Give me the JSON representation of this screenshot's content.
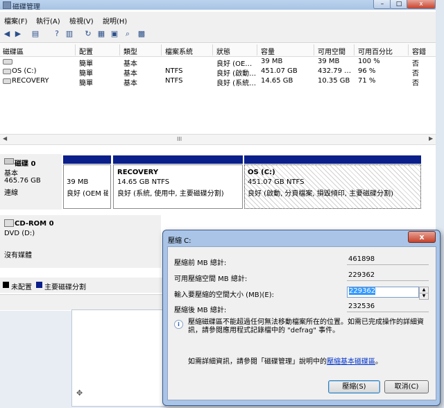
{
  "window": {
    "title": "磁碟管理"
  },
  "menu": [
    "檔案(F)",
    "執行(A)",
    "檢視(V)",
    "說明(H)"
  ],
  "columns": [
    "磁碟區",
    "配置",
    "類型",
    "檔案系統",
    "狀態",
    "容量",
    "可用空間",
    "可用百分比",
    "容錯"
  ],
  "volumes": [
    {
      "name": "",
      "layout": "簡單",
      "type": "基本",
      "fs": "",
      "status": "良好 (OE…",
      "capacity": "39 MB",
      "free": "39 MB",
      "pct": "100 %",
      "ft": "否"
    },
    {
      "name": "OS (C:)",
      "layout": "簡單",
      "type": "基本",
      "fs": "NTFS",
      "status": "良好 (啟動…",
      "capacity": "451.07 GB",
      "free": "432.79 …",
      "pct": "96 %",
      "ft": "否"
    },
    {
      "name": "RECOVERY",
      "layout": "簡單",
      "type": "基本",
      "fs": "NTFS",
      "status": "良好 (系統…",
      "capacity": "14.65 GB",
      "free": "10.35 GB",
      "pct": "71 %",
      "ft": "否"
    }
  ],
  "scroll": {
    "mid_glyph": "III"
  },
  "disk0": {
    "label": "磁碟 0",
    "type": "基本",
    "size": "465.76 GB",
    "state": "連線",
    "partitions": [
      {
        "title": "",
        "size": "39 MB",
        "status": "良好 (OEM 磁"
      },
      {
        "title": "RECOVERY",
        "size": "14.65 GB NTFS",
        "status": "良好 (系統, 使用中, 主要磁碟分割)"
      },
      {
        "title": "OS  (C:)",
        "size": "451.07 GB NTFS",
        "status": "良好 (啟動, 分頁檔案, 損毀傾印, 主要磁碟分割)"
      }
    ]
  },
  "cdrom": {
    "label": "CD-ROM 0",
    "drive": "DVD (D:)",
    "media": "沒有媒體"
  },
  "legend": {
    "unallocated": "未配置",
    "primary": "主要磁碟分割"
  },
  "dialog": {
    "title": "壓縮 C:",
    "total_before_label": "壓縮前 MB 總計:",
    "total_before": "461898",
    "available_label": "可用壓縮空間 MB 總計:",
    "available": "229362",
    "amount_label": "輸入要壓縮的空間大小 (MB)(E):",
    "amount": "229362",
    "total_after_label": "壓縮後 MB 總計:",
    "total_after": "232536",
    "info": "壓縮磁碟區不能超過任何無法移動檔案所在的位置。如需已完成操作的詳細資訊，請參閱應用程式記錄檔中的 \"defrag\" 事件。",
    "more_info_prefix": "如需詳細資訊，請參閱「磁碟管理」說明中的",
    "more_info_link": "壓縮基本磁碟區",
    "more_info_suffix": "。",
    "shrink_button": "壓縮(S)",
    "cancel_button": "取消(C)"
  },
  "colors": {
    "primary_partition": "#0a1f8a",
    "titlebar": "#a7c3e4"
  }
}
